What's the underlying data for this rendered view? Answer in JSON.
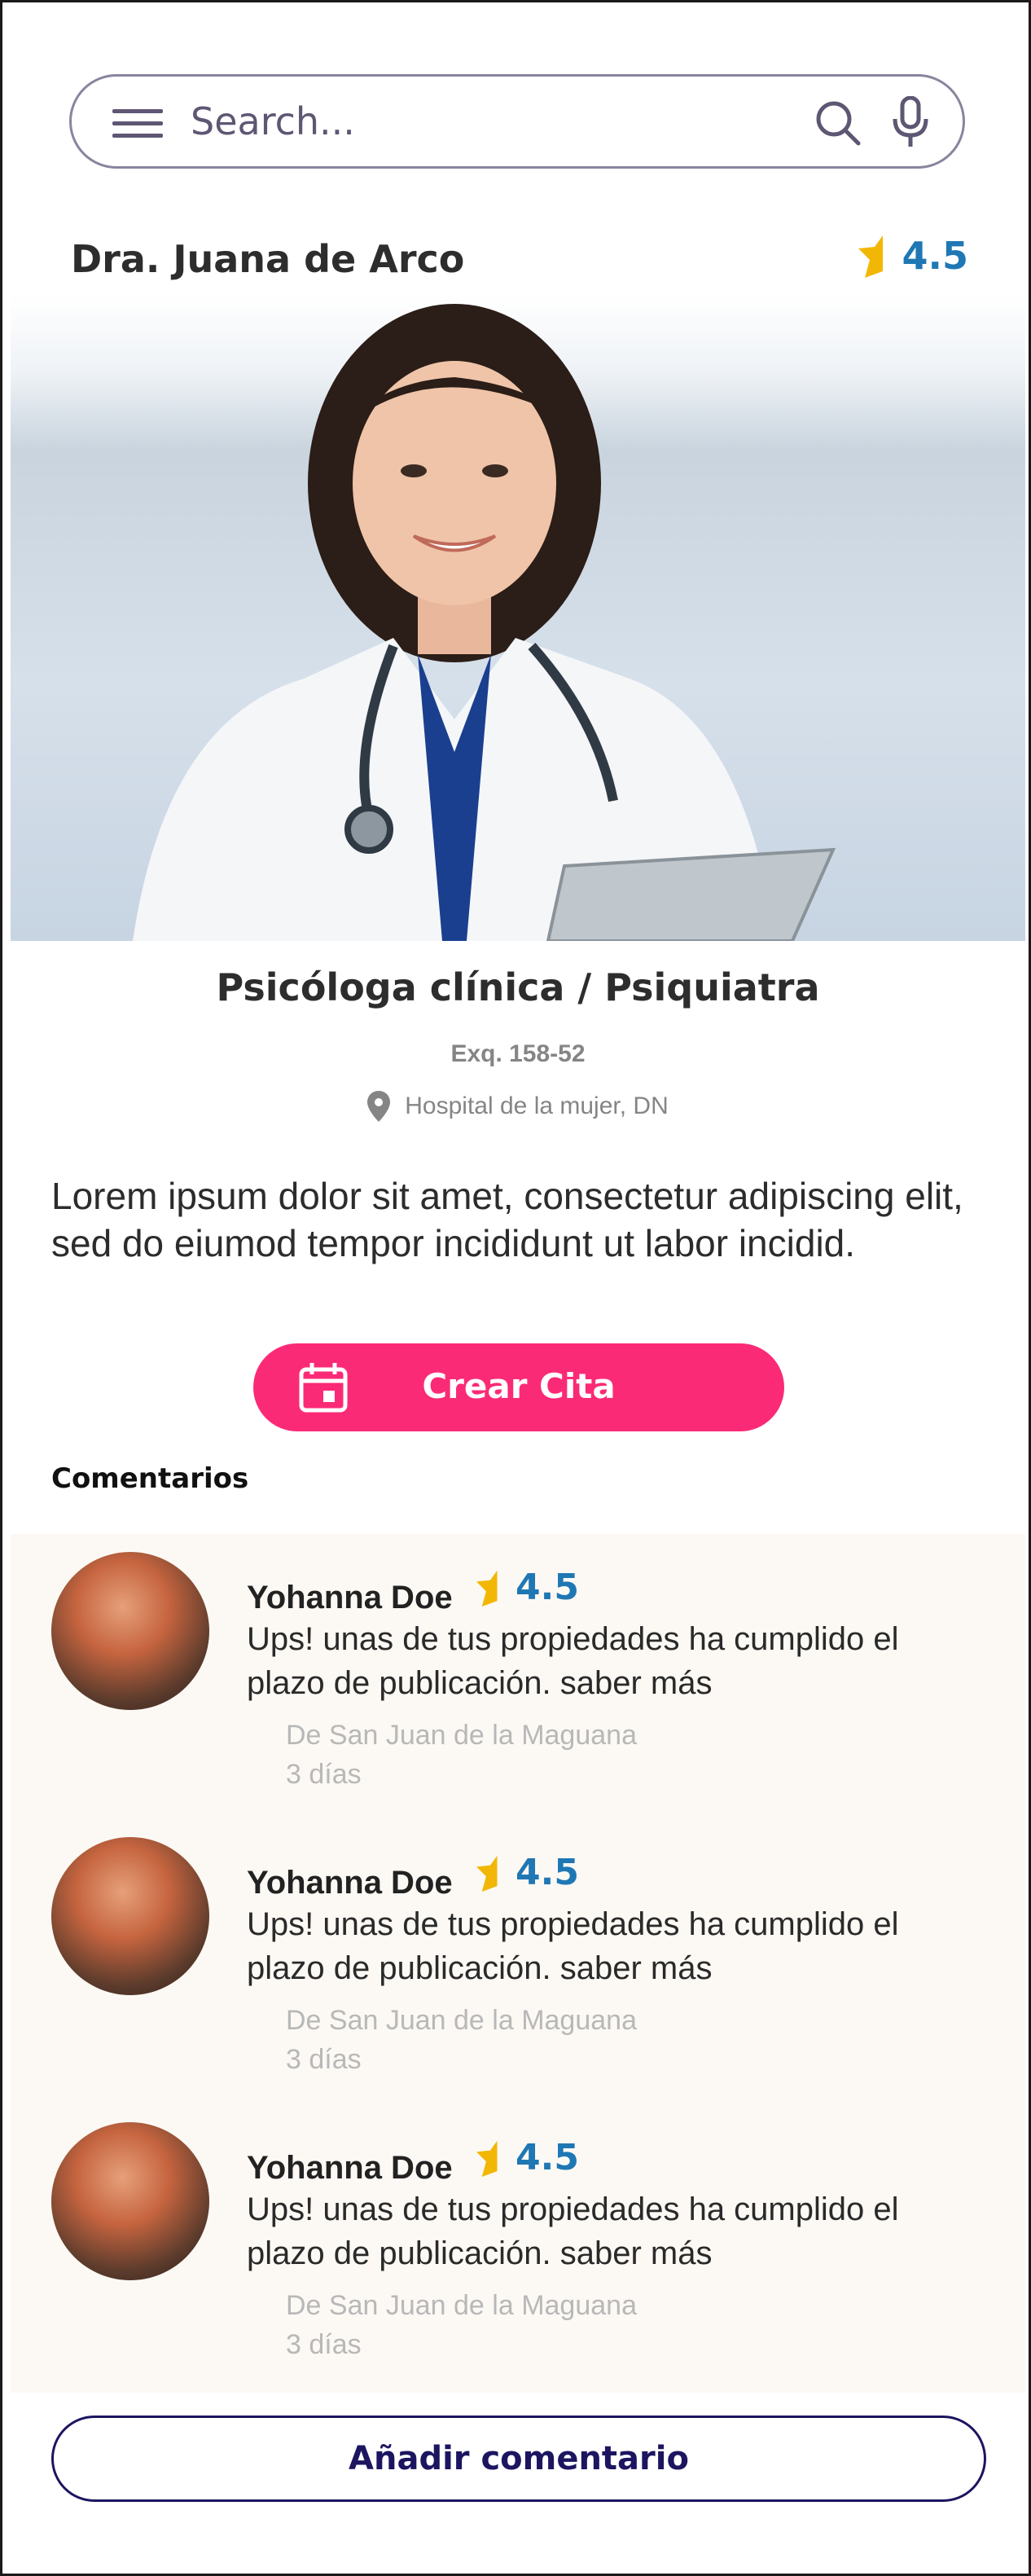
{
  "search": {
    "placeholder": "Search..."
  },
  "doctor": {
    "name": "Dra. Juana de Arco",
    "rating": "4.5",
    "specialty": "Psicóloga clínica / Psiquiatra",
    "exequatur": "Exq. 158-52",
    "location": "Hospital de la  mujer, DN",
    "description": "Lorem ipsum dolor sit amet, consectetur adipiscing elit, sed do eiumod tempor incididunt ut labor incidid."
  },
  "cta": {
    "label": "Crear Cita"
  },
  "comments_section": {
    "title": "Comentarios",
    "items": [
      {
        "name": "Yohanna Doe",
        "rating": "4.5",
        "text": "Ups! unas de tus propiedades ha cumplido el plazo de publicación. saber más",
        "location": "De San Juan de la Maguana",
        "time": "3 días"
      },
      {
        "name": "Yohanna Doe",
        "rating": "4.5",
        "text": "Ups! unas de tus propiedades ha cumplido el plazo de publicación. saber más",
        "location": "De San Juan de la Maguana",
        "time": "3 días"
      },
      {
        "name": "Yohanna Doe",
        "rating": "4.5",
        "text": "Ups! unas de tus propiedades ha cumplido el plazo de publicación. saber más",
        "location": "De San Juan de la Maguana",
        "time": "3 días"
      }
    ],
    "add_label": "Añadir comentario"
  },
  "colors": {
    "accent": "#fb2a76",
    "rating_text": "#1f77b4",
    "star": "#f2b705",
    "button_border": "#1c1560",
    "comments_bg": "#fcf9f4"
  },
  "icons": [
    "menu-icon",
    "search-icon",
    "microphone-icon",
    "star-icon",
    "location-pin-icon",
    "calendar-icon"
  ]
}
